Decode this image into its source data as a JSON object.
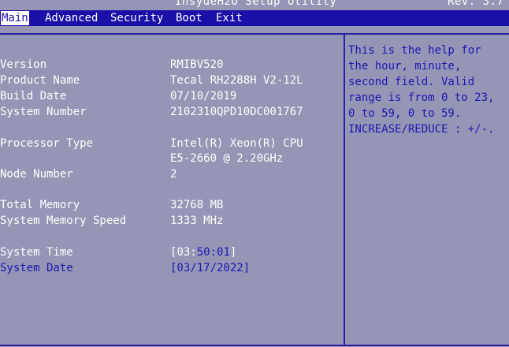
{
  "title": "InsydeH2O Setup Utility",
  "revision": "Rev. 3.7",
  "tabs": [
    "Main",
    "Advanced",
    "Security",
    "Boot",
    "Exit"
  ],
  "active_tab": "Main",
  "info": {
    "version_label": "Version",
    "version_value": "RMIBV520",
    "product_label": "Product Name",
    "product_value": "Tecal RH2288H V2-12L",
    "build_label": "Build Date",
    "build_value": "07/10/2019",
    "sysnum_label": "System Number",
    "sysnum_value": "2102310QPD10DC001767",
    "proc_label": "Processor Type",
    "proc_value_1": "Intel(R) Xeon(R) CPU",
    "proc_value_2": "E5-2660 @ 2.20GHz",
    "node_label": "Node Number",
    "node_value": "2",
    "mem_label": "Total Memory",
    "mem_value": "32768 MB",
    "memspeed_label": "System Memory Speed",
    "memspeed_value": "1333 MHz"
  },
  "time": {
    "label": "System Time",
    "open": "[",
    "hour": "03",
    "sep1": ":",
    "minute": "50",
    "sep2": ":",
    "second": "01",
    "close": "]"
  },
  "date": {
    "label": "System Date",
    "value": "[03/17/2022]"
  },
  "help": [
    "This is the help for",
    "the hour, minute,",
    "second field. Valid",
    "range is from 0 to 23,",
    "0 to 59, 0 to 59.",
    "INCREASE/REDUCE : +/-."
  ],
  "colors": {
    "background": "#9595b5",
    "menubar": "#1a10a8",
    "highlight_text": "#1f16b3",
    "text": "#ffffff"
  }
}
